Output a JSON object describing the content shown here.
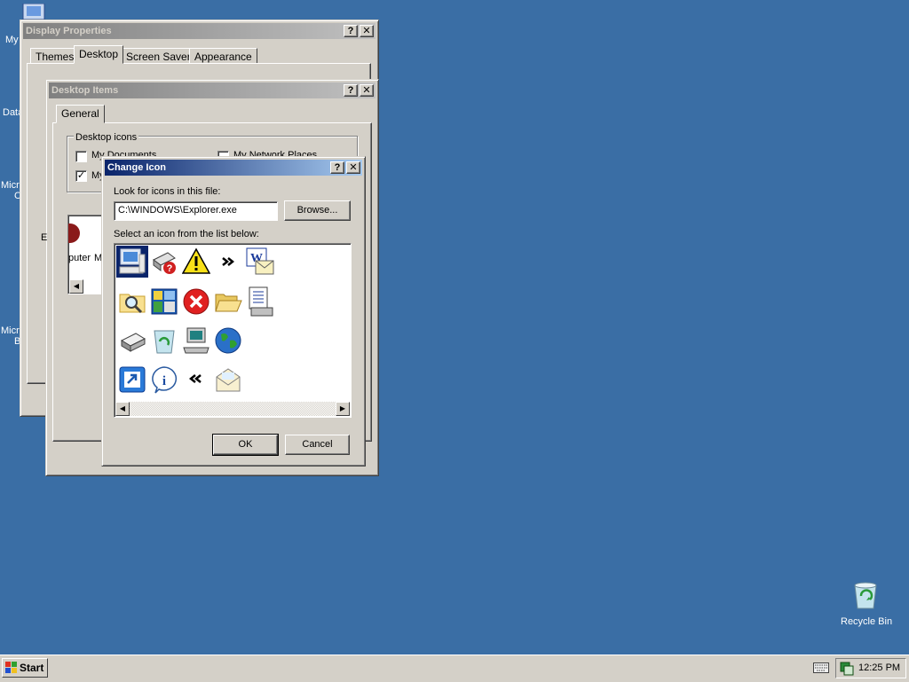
{
  "desktop": {
    "left_labels": [
      "My",
      "Data",
      "Micro",
      "C",
      "Micro",
      "B"
    ],
    "recycle_bin": "Recycle Bin"
  },
  "display_properties": {
    "title": "Display Properties",
    "tabs": [
      "Themes",
      "Desktop",
      "Screen Saver",
      "Appearance"
    ],
    "selected_tab": "Desktop"
  },
  "desktop_items": {
    "title": "Desktop Items",
    "tab": "General",
    "group_label": "Desktop icons",
    "checkboxes": [
      {
        "label": "My Documents",
        "checked": false
      },
      {
        "label": "My Network Places",
        "checked": false
      },
      {
        "label": "My",
        "checked": true
      }
    ],
    "list_fragments": [
      "E",
      "puter",
      "M"
    ]
  },
  "change_icon": {
    "title": "Change Icon",
    "file_label": "Look for icons in this file:",
    "file_value": "C:\\WINDOWS\\Explorer.exe",
    "browse_label": "Browse...",
    "list_label": "Select an icon from the list below:",
    "icons": [
      [
        "computer-icon",
        "printer-help-icon",
        "warning-icon",
        "chevron-right-icon",
        "word-document-icon"
      ],
      [
        "search-folder-icon",
        "control-panel-icon",
        "error-icon",
        "open-folder-icon",
        "text-document-icon"
      ],
      [
        "printer-icon",
        "recycle-bin-icon",
        "network-computer-icon",
        "globe-icon"
      ],
      [
        "shortcut-icon",
        "info-icon",
        "chevron-left-icon",
        "mail-icon"
      ]
    ],
    "ok_label": "OK",
    "cancel_label": "Cancel"
  },
  "taskbar": {
    "start_label": "Start",
    "clock": "12:25 PM"
  }
}
